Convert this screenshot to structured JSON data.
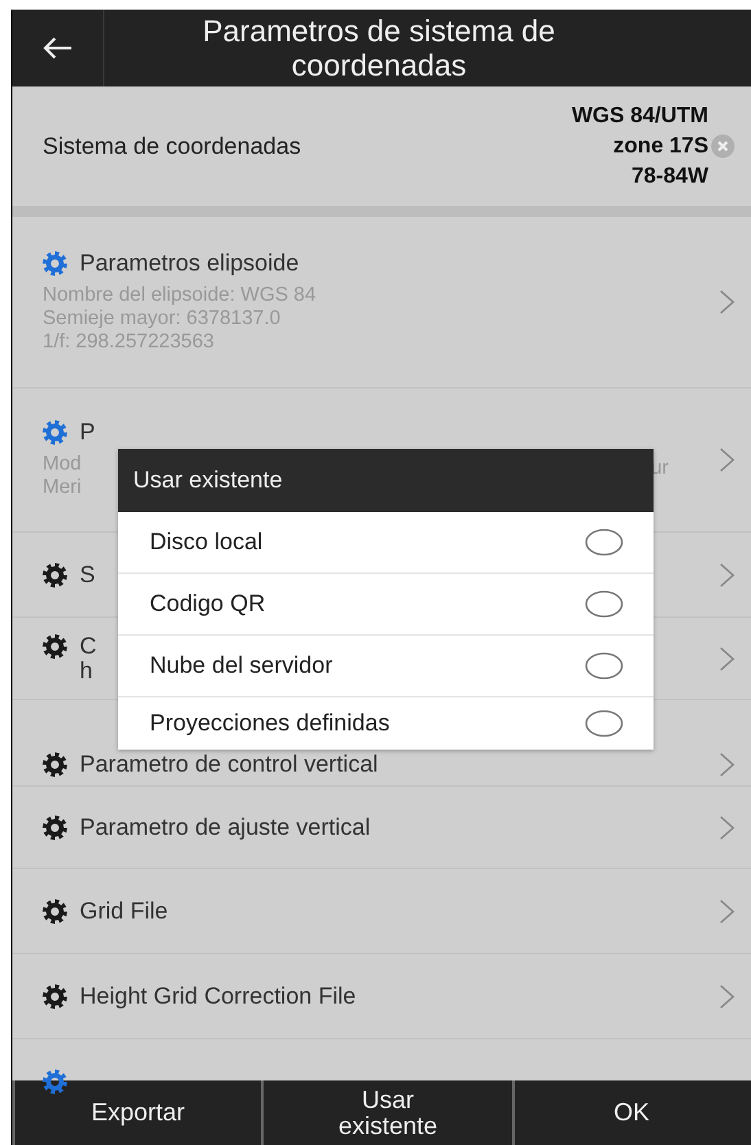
{
  "header": {
    "title": "Parametros de sistema de coordenadas"
  },
  "coordinate_system": {
    "label": "Sistema de coordenadas",
    "value_lines": [
      "WGS 84/UTM",
      "zone 17S",
      "78-84W"
    ]
  },
  "settings": [
    {
      "kind": "configured",
      "title_lines": [
        "Parametros elipsoide"
      ],
      "detail_lines": [
        "Nombre del elipsoide: WGS 84",
        "Semieje mayor: 6378137.0",
        "1/f: 298.257223563"
      ]
    },
    {
      "kind": "configured",
      "title_lines": [
        "P"
      ],
      "detail_lines": [
        "Mod",
        "Meri"
      ],
      "detail_tail": "ur"
    },
    {
      "kind": "default",
      "title_lines": [
        "S"
      ]
    },
    {
      "kind": "default",
      "title_lines": [
        "C",
        "h"
      ]
    },
    {
      "kind": "default",
      "title_lines": [
        "Parametro de control vertical"
      ]
    },
    {
      "kind": "default",
      "title_lines": [
        "Parametro de ajuste vertical"
      ]
    },
    {
      "kind": "default",
      "title_lines": [
        "Grid File"
      ]
    },
    {
      "kind": "default",
      "title_lines": [
        "Height Grid Correction File"
      ]
    },
    {
      "kind": "configured"
    }
  ],
  "dialog": {
    "title": "Usar existente",
    "options": [
      {
        "label": "Disco local",
        "selected": false
      },
      {
        "label": "Codigo QR",
        "selected": false
      },
      {
        "label": "Nube del servidor",
        "selected": false
      },
      {
        "label": "Proyecciones definidas",
        "selected": false
      }
    ]
  },
  "bottom_bar": [
    {
      "label": "Exportar"
    },
    {
      "label": "Usar existente"
    },
    {
      "label": "OK"
    }
  ]
}
